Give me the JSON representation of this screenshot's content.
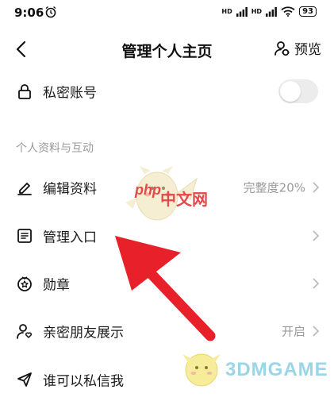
{
  "status_bar": {
    "time": "9:06",
    "battery": "93",
    "hd_label": "HD"
  },
  "nav": {
    "title": "管理个人主页",
    "preview_label": "预览"
  },
  "private_account": {
    "label": "私密账号",
    "toggle_on": false
  },
  "section_title": "个人资料与互动",
  "rows": [
    {
      "label": "编辑资料",
      "value": "完整度20%"
    },
    {
      "label": "管理入口",
      "value": ""
    },
    {
      "label": "勋章",
      "value": ""
    },
    {
      "label": "亲密朋友展示",
      "value": "开启"
    },
    {
      "label": "谁可以私信我",
      "value": ""
    }
  ],
  "watermarks": {
    "php": "php",
    "php_cn": "中文网",
    "game": "3DMGAME"
  },
  "colors": {
    "arrow": "#e8202a",
    "accent_text": "#1a1a1a",
    "muted_text": "#9a9a9a"
  }
}
